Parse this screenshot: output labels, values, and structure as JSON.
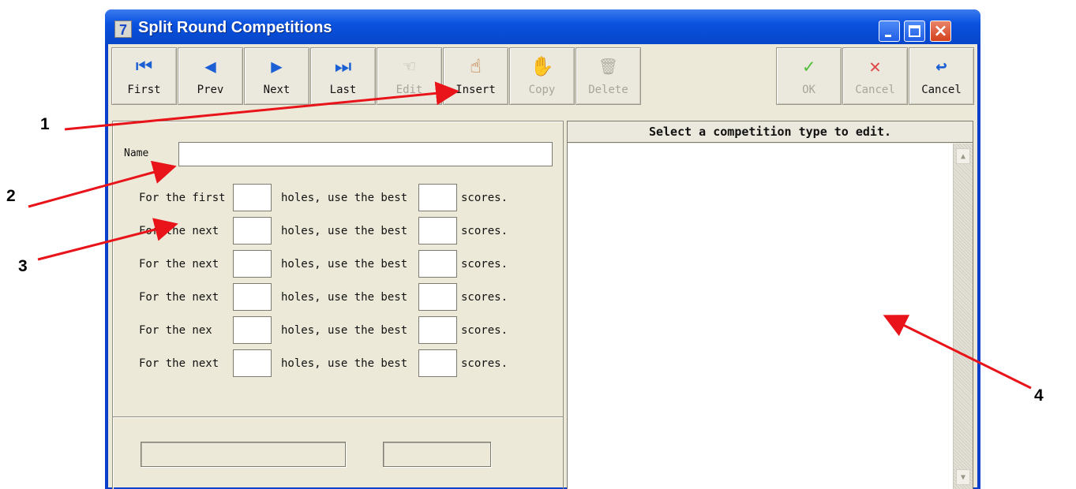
{
  "window": {
    "icon_glyph": "7",
    "title": "Split Round Competitions",
    "controls": {
      "minimize": "minimize-icon",
      "maximize": "maximize-icon",
      "close": "close-icon",
      "close_glyph": "×"
    }
  },
  "toolbar": {
    "buttons": [
      {
        "label": "First",
        "icon": "first-record-icon",
        "glyph": "⏮",
        "disabled": false
      },
      {
        "label": "Prev",
        "icon": "prev-record-icon",
        "glyph": "◀",
        "disabled": false
      },
      {
        "label": "Next",
        "icon": "next-record-icon",
        "glyph": "▶",
        "disabled": false
      },
      {
        "label": "Last",
        "icon": "last-record-icon",
        "glyph": "⏭",
        "disabled": false
      },
      {
        "label": "Edit",
        "icon": "edit-hand-icon",
        "glyph": "☜",
        "disabled": true
      },
      {
        "label": "Insert",
        "icon": "insert-hand-icon",
        "glyph": "☝",
        "disabled": false
      },
      {
        "label": "Copy",
        "icon": "copy-hand-icon",
        "glyph": "✋",
        "disabled": true
      },
      {
        "label": "Delete",
        "icon": "trash-icon",
        "glyph": "🗑",
        "disabled": true
      },
      {
        "label": "OK",
        "icon": "checkmark-icon",
        "glyph": "✓",
        "disabled": true
      },
      {
        "label": "Cancel",
        "icon": "cancel-x-icon",
        "glyph": "✕",
        "disabled": true
      },
      {
        "label": "Cancel",
        "icon": "return-arrow-icon",
        "glyph": "↩",
        "disabled": false
      }
    ]
  },
  "form": {
    "name_label": "Name",
    "name_value": "",
    "rows": [
      {
        "prefix": "For the first",
        "middle": "holes, use the best",
        "suffix": "scores."
      },
      {
        "prefix": "For the next",
        "middle": "holes, use the best",
        "suffix": "scores."
      },
      {
        "prefix": "For the next",
        "middle": "holes, use the best",
        "suffix": "scores."
      },
      {
        "prefix": "For the next",
        "middle": "holes, use the best",
        "suffix": "scores."
      },
      {
        "prefix": "For the nex",
        "middle": "holes, use the best",
        "suffix": "scores."
      },
      {
        "prefix": "For the next",
        "middle": "holes, use the best",
        "suffix": "scores."
      }
    ]
  },
  "list": {
    "header": "Select a competition type to edit.",
    "scroll_up_glyph": "▲",
    "scroll_down_glyph": "▼"
  },
  "annotations": [
    "1",
    "2",
    "3",
    "4"
  ],
  "annotation_color": "#e8141a"
}
